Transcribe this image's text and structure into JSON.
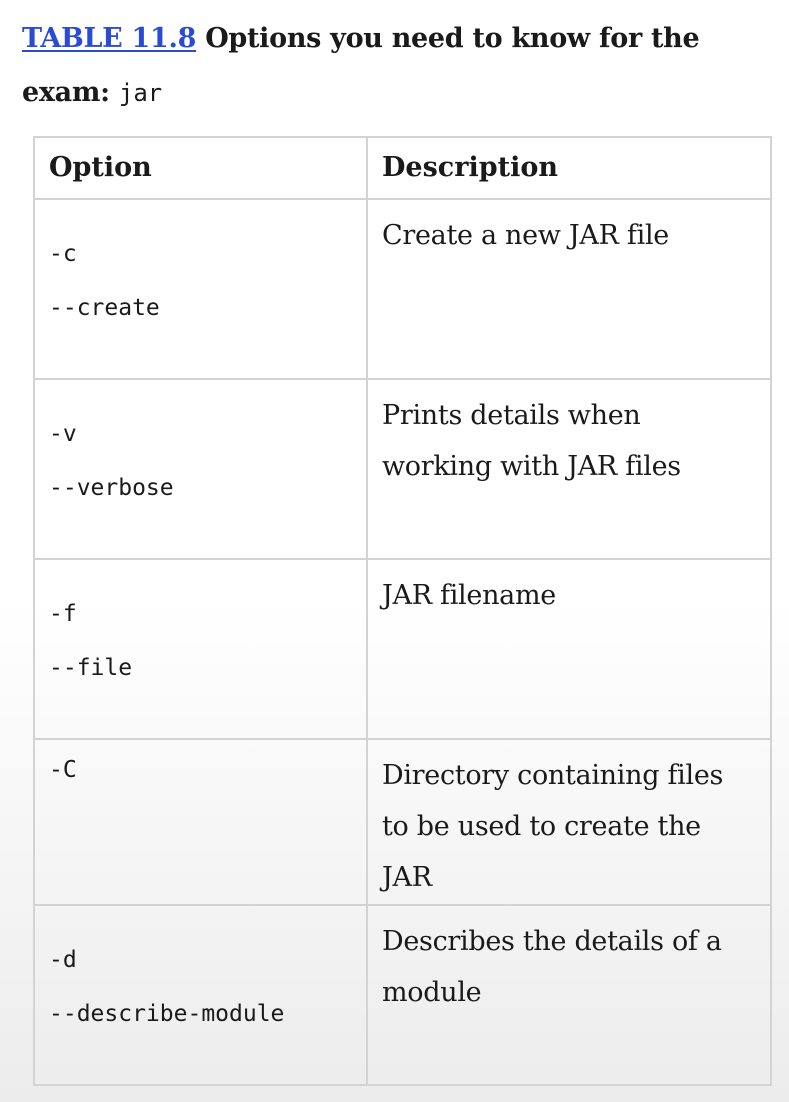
{
  "caption": {
    "table_ref": "TABLE 11.8",
    "text": " Options you need to know for the exam: ",
    "code": "jar"
  },
  "table": {
    "headers": {
      "option": "Option",
      "description": "Description"
    },
    "rows": [
      {
        "short": "-c",
        "long": "--create",
        "description": "Create a new JAR file"
      },
      {
        "short": "-v",
        "long": "--verbose",
        "description": "Prints details when working with JAR files"
      },
      {
        "short": "-f",
        "long": "--file",
        "description": "JAR filename"
      },
      {
        "short": "-C",
        "long": "",
        "description": "Directory containing files to be used to create the JAR"
      },
      {
        "short": "-d",
        "long": "--describe-module",
        "description": "Describes the details of a module"
      }
    ]
  }
}
